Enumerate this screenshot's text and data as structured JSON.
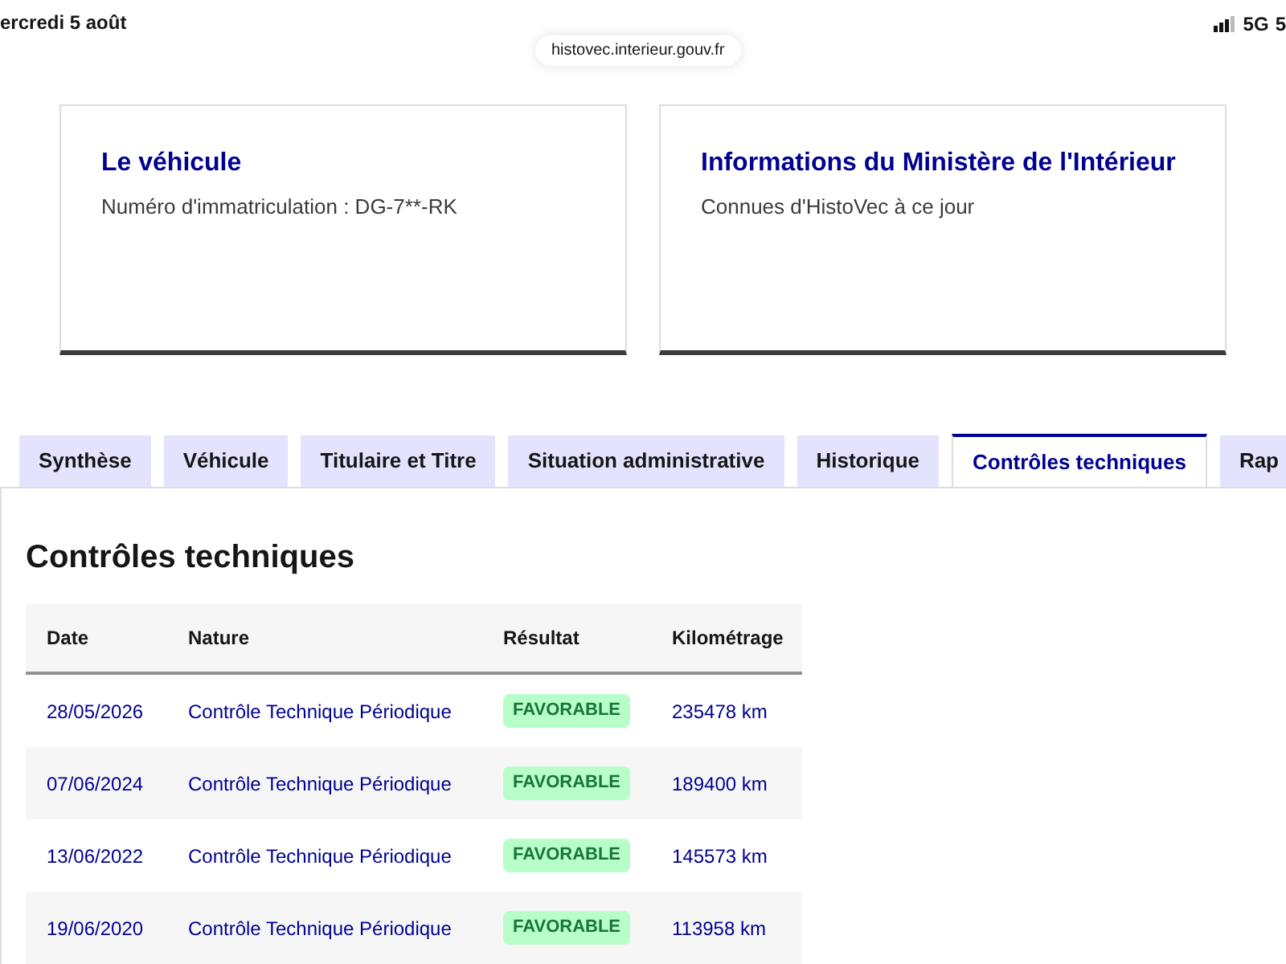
{
  "status_bar": {
    "date": "ercredi 5 août",
    "network": "5G",
    "battery": "5"
  },
  "address_bar": {
    "url": "histovec.interieur.gouv.fr"
  },
  "cards": [
    {
      "title": "Le véhicule",
      "text": "Numéro d'immatriculation : DG-7**-RK"
    },
    {
      "title": "Informations du Ministère de l'Intérieur",
      "text": "Connues d'HistoVec à ce jour"
    }
  ],
  "tabs": [
    {
      "label": "Synthèse",
      "selected": false
    },
    {
      "label": "Véhicule",
      "selected": false
    },
    {
      "label": "Titulaire et Titre",
      "selected": false
    },
    {
      "label": "Situation administrative",
      "selected": false
    },
    {
      "label": "Historique",
      "selected": false
    },
    {
      "label": "Contrôles techniques",
      "selected": true
    },
    {
      "label": "Rap",
      "selected": false
    }
  ],
  "section": {
    "title": "Contrôles techniques"
  },
  "table": {
    "columns": [
      "Date",
      "Nature",
      "Résultat",
      "Kilométrage"
    ],
    "rows": [
      {
        "date": "28/05/2026",
        "nature": "Contrôle Technique Périodique",
        "result": "FAVORABLE",
        "km": "235478 km"
      },
      {
        "date": "07/06/2024",
        "nature": "Contrôle Technique Périodique",
        "result": "FAVORABLE",
        "km": "189400 km"
      },
      {
        "date": "13/06/2022",
        "nature": "Contrôle Technique Périodique",
        "result": "FAVORABLE",
        "km": "145573 km"
      },
      {
        "date": "19/06/2020",
        "nature": "Contrôle Technique Périodique",
        "result": "FAVORABLE",
        "km": "113958 km"
      }
    ]
  }
}
